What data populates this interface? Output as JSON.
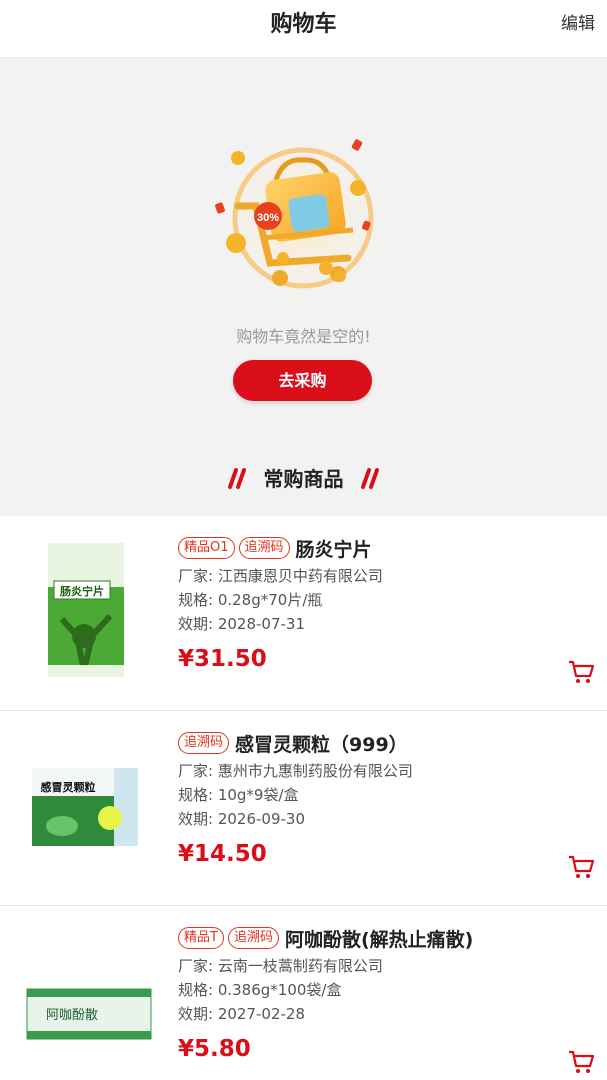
{
  "header": {
    "title": "购物车",
    "edit_label": "编辑"
  },
  "empty_state": {
    "badge": "30%",
    "message": "购物车竟然是空的!",
    "button_label": "去采购"
  },
  "section": {
    "title": "常购商品"
  },
  "colors": {
    "accent": "#d90e19",
    "tag": "#e0341e",
    "background": "#f2f2f2"
  },
  "products": [
    {
      "tags": [
        "精品O1",
        "追溯码"
      ],
      "name": "肠炎宁片",
      "manufacturer": "厂家: 江西康恩贝中药有限公司",
      "spec": "规格: 0.28g*70片/瓶",
      "expiry": "效期: 2028-07-31",
      "price": "¥31.50",
      "box_text": "肠炎宁片"
    },
    {
      "tags": [
        "追溯码"
      ],
      "name": "感冒灵颗粒（999）",
      "manufacturer": "厂家: 惠州市九惠制药股份有限公司",
      "spec": "规格: 10g*9袋/盒",
      "expiry": "效期: 2026-09-30",
      "price": "¥14.50",
      "box_text": "感冒灵颗粒"
    },
    {
      "tags": [
        "精品T",
        "追溯码"
      ],
      "name": "阿咖酚散(解热止痛散)",
      "manufacturer": "厂家: 云南一枝蒿制药有限公司",
      "spec": "规格: 0.386g*100袋/盒",
      "expiry": "效期: 2027-02-28",
      "price": "¥5.80",
      "box_text": "阿咖酚散"
    }
  ]
}
